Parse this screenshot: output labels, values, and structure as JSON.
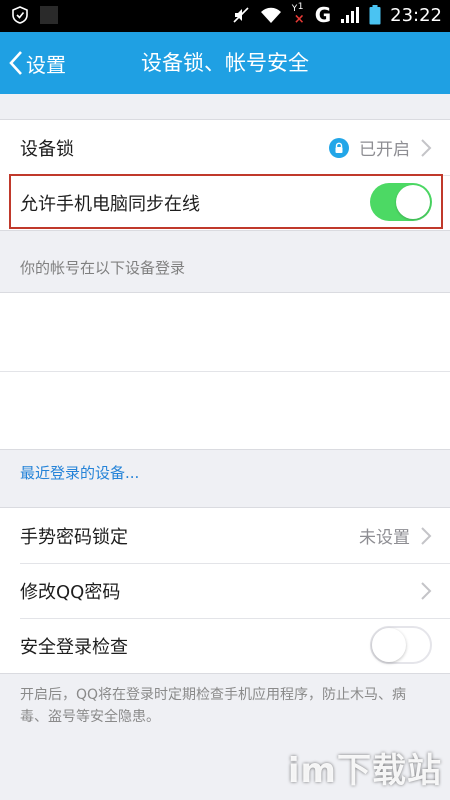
{
  "status_bar": {
    "network": "G",
    "sim_badge": "1",
    "time": "23:22",
    "icons": [
      "shield-check-icon",
      "mute-icon",
      "wifi-icon",
      "no-signal-icon",
      "signal-icon",
      "battery-icon"
    ]
  },
  "header": {
    "back_label": "设置",
    "title": "设备锁、帐号安全",
    "color": "#1fa0e3"
  },
  "device_lock": {
    "label": "设备锁",
    "value": "已开启"
  },
  "sync_online": {
    "label": "允许手机电脑同步在线",
    "enabled": true
  },
  "devices_section": {
    "header": "你的帐号在以下设备登录",
    "recent_link": "最近登录的设备..."
  },
  "gesture_lock": {
    "label": "手势密码锁定",
    "value": "未设置"
  },
  "change_password": {
    "label": "修改QQ密码"
  },
  "safe_login_check": {
    "label": "安全登录检查",
    "enabled": false
  },
  "note": "开启后，QQ将在登录时定期检查手机应用程序，防止木马、病毒、盗号等安全隐患。",
  "watermark": "im下载站",
  "colors": {
    "accent": "#1fa0e3",
    "toggle_on": "#4cd964",
    "link": "#2583d8",
    "highlight": "#c0392b"
  }
}
